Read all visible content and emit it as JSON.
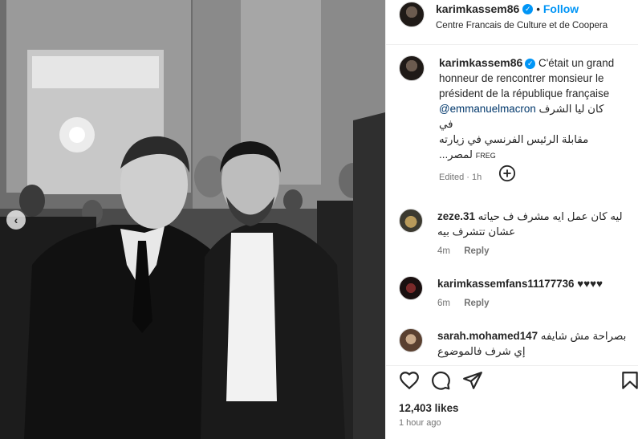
{
  "photo": {
    "alt": "Black and white photo of two men"
  },
  "post": {
    "username": "karimkassem86",
    "verified_mark": "✓",
    "separator": "•",
    "follow_label": "Follow",
    "location": "Centre Francais de Culture et de Coopera"
  },
  "caption": {
    "username": "karimkassem86",
    "text_before": " C'était un grand honneur de rencontrer monsieur le président de la république française ",
    "mention": "@emmanuelmacron",
    "arabic_line1": "كان ليا الشرف في",
    "arabic_line2": "مقابلة الرئيس الفرنسي في زيارته لمصر...",
    "more_label": "FREG",
    "meta": "Edited · 1h"
  },
  "comments": [
    {
      "username": "zeze.31",
      "text": "ليه كان عمل ايه مشرف ف حياته عشان تتشرف بيه",
      "time": "4m",
      "reply_label": "Reply"
    },
    {
      "username": "karimkassemfans11177736",
      "text": "♥♥♥♥",
      "time": "6m",
      "reply_label": "Reply"
    },
    {
      "username": "sarah.mohamed147",
      "text": "بصراحة مش شايفه إي شرف فالموضوع",
      "time": "",
      "reply_label": ""
    }
  ],
  "actions": {
    "likes": "12,403 likes",
    "time": "1 hour ago"
  },
  "icons": [
    "chevron-left-icon",
    "add-circle-icon",
    "heart-icon",
    "comment-icon",
    "share-icon",
    "bookmark-icon",
    "verified-icon"
  ],
  "colors": {
    "accent": "#0095f6",
    "mention": "#00376b",
    "muted": "#737373"
  }
}
